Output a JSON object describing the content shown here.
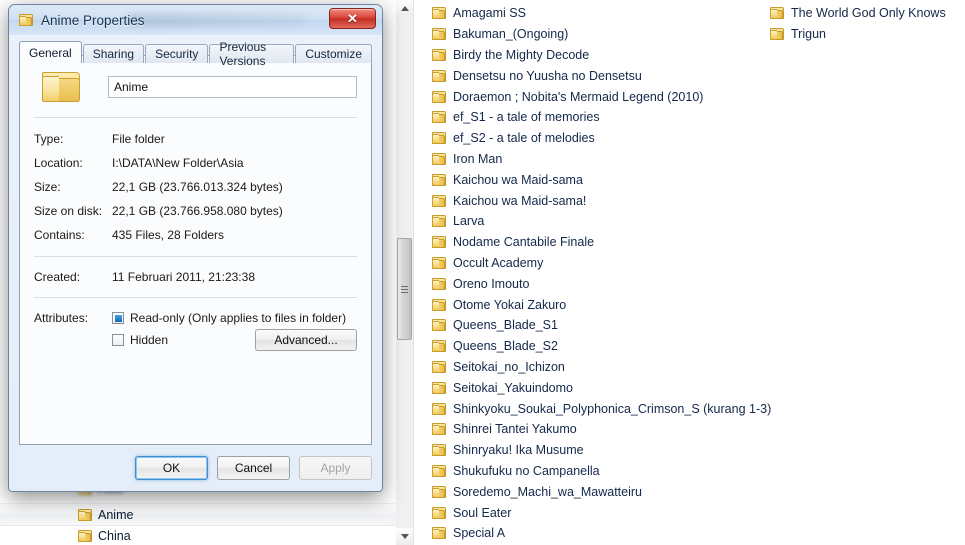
{
  "dialog": {
    "title": "Anime Properties",
    "title_icon": "folder-icon",
    "close_label": "✕",
    "tabs": [
      {
        "label": "General",
        "active": true
      },
      {
        "label": "Sharing",
        "active": false
      },
      {
        "label": "Security",
        "active": false
      },
      {
        "label": "Previous Versions",
        "active": false
      },
      {
        "label": "Customize",
        "active": false
      }
    ],
    "name_field": {
      "value": "Anime",
      "placeholder": ""
    },
    "properties": [
      {
        "key": "Type:",
        "value": "File folder"
      },
      {
        "key": "Location:",
        "value": "I:\\DATA\\New Folder\\Asia"
      },
      {
        "key": "Size:",
        "value": "22,1 GB (23.766.013.324 bytes)"
      },
      {
        "key": "Size on disk:",
        "value": "22,1 GB (23.766.958.080 bytes)"
      },
      {
        "key": "Contains:",
        "value": "435 Files, 28 Folders"
      }
    ],
    "created": {
      "key": "Created:",
      "value": "11 Februari 2011, 21:23:38"
    },
    "attributes": {
      "key": "Attributes:",
      "readonly_label": "Read-only (Only applies to files in folder)",
      "readonly_checked": true,
      "hidden_label": "Hidden",
      "hidden_checked": false,
      "advanced_label": "Advanced..."
    },
    "buttons": {
      "ok": "OK",
      "cancel": "Cancel",
      "apply": "Apply",
      "apply_disabled": true
    }
  },
  "nav_tree": {
    "items": [
      {
        "label": "Asia",
        "selected": false,
        "blurred": true
      },
      {
        "label": "Anime",
        "selected": true,
        "blurred": false
      },
      {
        "label": "China",
        "selected": false,
        "blurred": false
      }
    ]
  },
  "file_list": {
    "column_a": [
      "Amagami SS",
      "Bakuman_(Ongoing)",
      "Birdy the Mighty Decode",
      "Densetsu no Yuusha no Densetsu",
      "Doraemon ; Nobita's Mermaid Legend (2010)",
      "ef_S1 - a tale of memories",
      "ef_S2 - a tale of melodies",
      "Iron Man",
      "Kaichou wa Maid-sama",
      "Kaichou wa Maid-sama!",
      "Larva",
      "Nodame Cantabile Finale",
      "Occult Academy",
      "Oreno Imouto",
      "Otome Yokai Zakuro",
      "Queens_Blade_S1",
      "Queens_Blade_S2",
      "Seitokai_no_Ichizon",
      "Seitokai_Yakuindomo",
      "Shinkyoku_Soukai_Polyphonica_Crimson_S (kurang 1-3)",
      "Shinrei Tantei Yakumo",
      "Shinryaku! Ika Musume",
      "Shukufuku no Campanella",
      "Soredemo_Machi_wa_Mawatteiru",
      "Soul Eater",
      "Special A"
    ],
    "column_b": [
      "The World God Only Knows",
      "Trigun"
    ]
  },
  "scrollbar": {
    "up_arrow": "scroll-up-icon",
    "down_arrow": "scroll-down-icon"
  },
  "colors": {
    "accent_blue": "#3c8fd4",
    "close_red": "#c32f24",
    "folder_yellow": "#f0cf67",
    "text_dark": "#14284a"
  }
}
